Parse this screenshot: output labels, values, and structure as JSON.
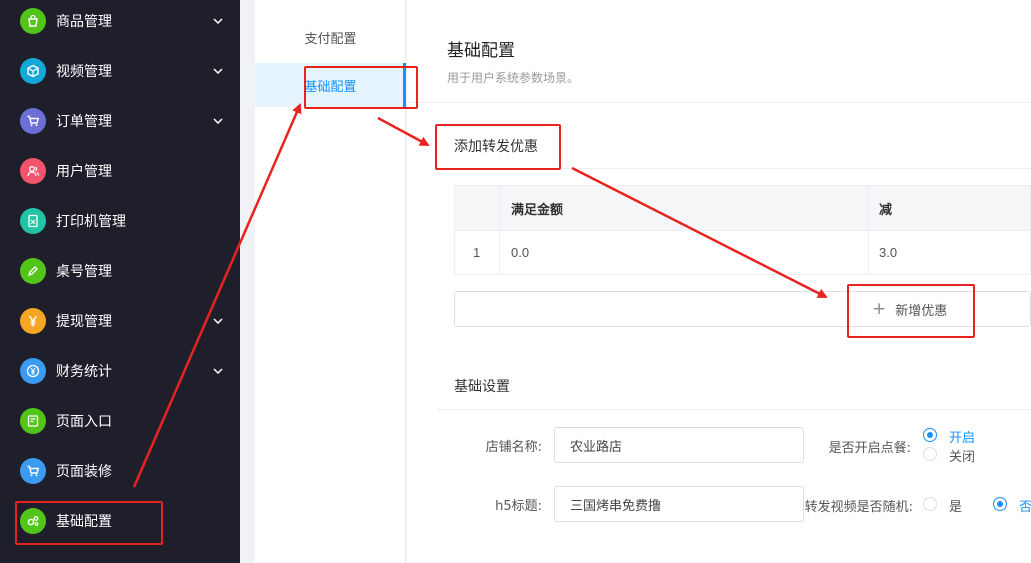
{
  "sidebar": {
    "items": [
      {
        "label": "商品管理",
        "icon": "bag-icon",
        "color": "#52c41a",
        "has_chevron": true
      },
      {
        "label": "视频管理",
        "icon": "cube-icon",
        "color": "#13a8d8",
        "has_chevron": true
      },
      {
        "label": "订单管理",
        "icon": "cart-icon",
        "color": "#6c6fd6",
        "has_chevron": true
      },
      {
        "label": "用户管理",
        "icon": "users-icon",
        "color": "#f0556b",
        "has_chevron": false
      },
      {
        "label": "打印机管理",
        "icon": "printer-doc-icon",
        "color": "#22c3a6",
        "has_chevron": false
      },
      {
        "label": "桌号管理",
        "icon": "pen-icon",
        "color": "#52c41a",
        "has_chevron": false
      },
      {
        "label": "提现管理",
        "icon": "yen-icon",
        "color": "#f5a623",
        "has_chevron": true
      },
      {
        "label": "财务统计",
        "icon": "yen-circle-icon",
        "color": "#3a9bf0",
        "has_chevron": true
      },
      {
        "label": "页面入口",
        "icon": "page-edit-icon",
        "color": "#52c41a",
        "has_chevron": false
      },
      {
        "label": "页面装修",
        "icon": "cart-icon",
        "color": "#3a9bf0",
        "has_chevron": false
      },
      {
        "label": "基础配置",
        "icon": "gears-icon",
        "color": "#52c41a",
        "has_chevron": false
      }
    ]
  },
  "submenu": {
    "items": [
      {
        "label": "支付配置",
        "active": false
      },
      {
        "label": "基础配置",
        "active": true
      }
    ]
  },
  "main": {
    "title": "基础配置",
    "desc": "用于用户系统参数场景。",
    "forward_section_title": "添加转发优惠",
    "table": {
      "headers": [
        "满足金额",
        "减"
      ],
      "rows": [
        {
          "index": "1",
          "amount": "0.0",
          "minus": "3.0"
        }
      ]
    },
    "add_button_label": "新增优惠",
    "basic_section_title": "基础设置",
    "form": {
      "store_name_label": "店铺名称:",
      "store_name_value": "农业路店",
      "h5_title_label": "h5标题:",
      "h5_title_value": "三国烤串免费撸",
      "order_switch_label": "是否开启点餐:",
      "order_on_label": "开启",
      "order_off_label": "关闭",
      "random_video_label": "转发视频是否随机:",
      "random_yes_label": "是",
      "random_no_label": "否"
    }
  },
  "colors": {
    "sidebar_bg": "#1e1f2b",
    "accent": "#1890ff",
    "annotation": "#e8231f"
  }
}
